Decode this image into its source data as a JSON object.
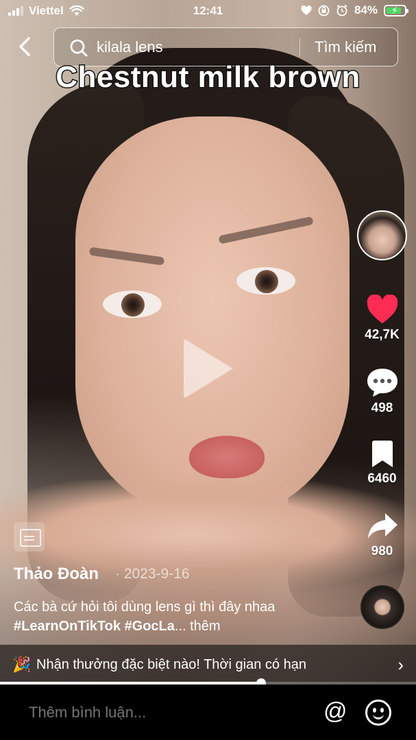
{
  "status_bar": {
    "carrier": "Viettel",
    "time": "12:41",
    "battery_percent": "84%",
    "battery_level": 0.84,
    "icons": [
      "signal-icon",
      "wifi-icon",
      "heart-icon",
      "orientation-lock-icon",
      "alarm-icon",
      "battery-charging-icon"
    ]
  },
  "search": {
    "query": "kilala lens",
    "submit_label": "Tìm kiếm"
  },
  "video": {
    "overlay_title": "Chestnut milk brown",
    "state_icon": "play-icon"
  },
  "actions": {
    "likes": "42,7K",
    "comments": "498",
    "saves": "6460",
    "shares": "980",
    "like_color": "#fe2c55"
  },
  "post": {
    "author": "Thảo Đoàn",
    "date": "· 2023-9-16",
    "caption_text": "Các bà cứ hỏi tôi dùng lens gì thì đây nhaa ",
    "hashtags": "#LearnOnTikTok #GocLa",
    "ellipsis": "... ",
    "more_label": "thêm"
  },
  "promo": {
    "emoji": "🎉",
    "text": "Nhận thưởng đặc biệt nào! Thời gian có hạn",
    "chevron": "›"
  },
  "progress": {
    "fraction": 0.627
  },
  "comment_bar": {
    "placeholder": "Thêm bình luận...",
    "mention_symbol": "@"
  }
}
